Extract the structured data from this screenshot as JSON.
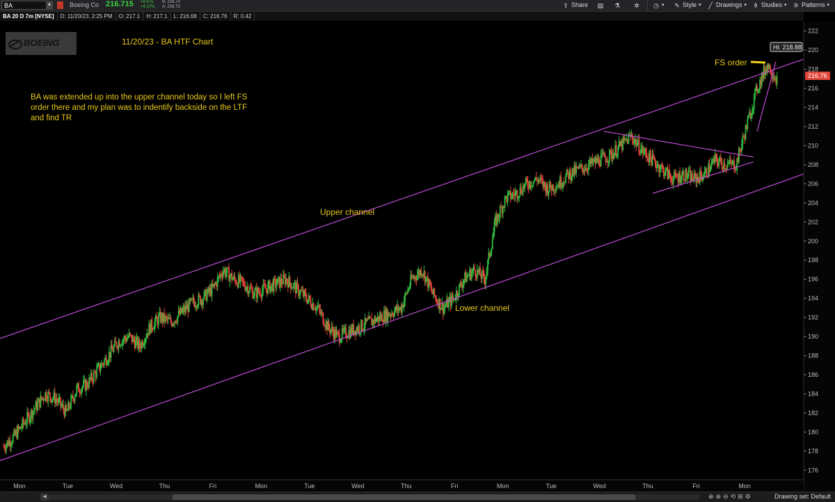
{
  "header": {
    "symbol": "BA",
    "company": "Boeing Co",
    "last_price": "216.715",
    "change": "+8.675",
    "change_pct": "+4.17%",
    "bid": "B: 216.70",
    "ask": "A: 216.73",
    "toolbar": {
      "share": "Share",
      "style": "Style",
      "drawings": "Drawings",
      "studies": "Studies",
      "patterns": "Patterns"
    }
  },
  "infobar": {
    "study": "BA 20 D 7m [NYSE]",
    "date": "D: 11/20/23, 2:25 PM",
    "open": "O: 217.1",
    "high": "H: 217.1",
    "low": "L: 216.68",
    "close": "C: 216.76",
    "range": "R: 0.42"
  },
  "chart_data": {
    "type": "candlestick",
    "ylim": [
      175,
      223
    ],
    "y_ticks": [
      "176",
      "178",
      "180",
      "182",
      "184",
      "186",
      "188",
      "190",
      "192",
      "194",
      "196",
      "198",
      "200",
      "202",
      "204",
      "206",
      "208",
      "210",
      "212",
      "214",
      "216",
      "218",
      "220",
      "222"
    ],
    "x_labels": [
      "Mon",
      "Tue",
      "Wed",
      "Thu",
      "Fri",
      "Mon",
      "Tue",
      "Wed",
      "Thu",
      "Fri",
      "Mon",
      "Tue",
      "Wed",
      "Thu",
      "Fri",
      "Mon"
    ],
    "series": [
      {
        "name": "Close",
        "values": [
          178.5,
          179.5,
          181,
          182.5,
          184,
          183.5,
          182,
          184.5,
          185,
          186.5,
          188,
          189.5,
          190,
          189,
          191,
          192,
          191.5,
          192.5,
          193.5,
          194,
          195,
          197,
          196,
          195.5,
          194.5,
          195,
          195.5,
          196,
          195,
          194,
          193,
          191,
          190,
          190.5,
          191,
          191.5,
          192,
          192.5,
          193,
          196,
          197,
          194.5,
          193,
          194,
          196,
          197,
          196,
          202,
          204.5,
          205,
          206,
          206.5,
          205.5,
          206,
          207,
          207.5,
          208,
          208.5,
          209,
          210,
          211,
          209.5,
          208.5,
          207.5,
          206.5,
          207,
          206.5,
          207,
          208.5,
          208,
          208,
          212,
          216,
          218.5,
          216.8
        ]
      }
    ],
    "hi_label": "Hi: 218.88",
    "last_label": "216.76",
    "colors": {
      "up": "#2fbf3f",
      "down": "#e0463a",
      "channel": "#c04bd6",
      "annotation": "#f0d21c",
      "hi_tag": "#dddddd",
      "last_tag": "#e0463a"
    },
    "annotations": {
      "title": "11/20/23 - BA HTF Chart",
      "note": "BA was extended up into the upper channel today so I left FS order there and my plan was to indentify backside on the LTF and find TR",
      "upper_channel": "Upper channel",
      "lower_channel": "Lower channel",
      "fs_order": "FS order",
      "logo": "BOEING"
    }
  },
  "bottombar": {
    "drawing_set": "Drawing set: Default"
  }
}
